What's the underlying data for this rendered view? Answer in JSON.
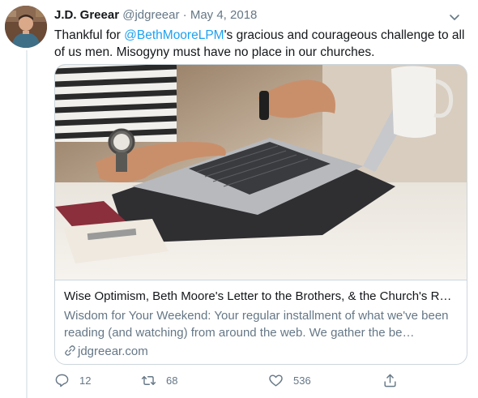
{
  "tweet": {
    "author_name": "J.D. Greear",
    "handle": "@jdgreear",
    "separator": "·",
    "date": "May 4, 2018",
    "text_before": "Thankful for ",
    "mention": "@BethMooreLPM",
    "text_after": "'s gracious and courageous challenge to all of us men. Misogyny must have no place in our churches."
  },
  "card": {
    "title": "Wise Optimism, Beth Moore's Letter to the Brothers, & the Church's R…",
    "description": "Wisdom for Your Weekend: Your regular installment of what we've been reading (and watching) from around the web. We gather the be…",
    "domain": "jdgreear.com"
  },
  "actions": {
    "reply_count": "12",
    "retweet_count": "68",
    "like_count": "536"
  },
  "colors": {
    "accent": "#1da1f2",
    "secondary_text": "#657786",
    "border": "#ccd6dd"
  },
  "icons": [
    "avatar-photo",
    "chevron-down-icon",
    "link-icon",
    "reply-icon",
    "retweet-icon",
    "like-icon",
    "share-icon"
  ]
}
